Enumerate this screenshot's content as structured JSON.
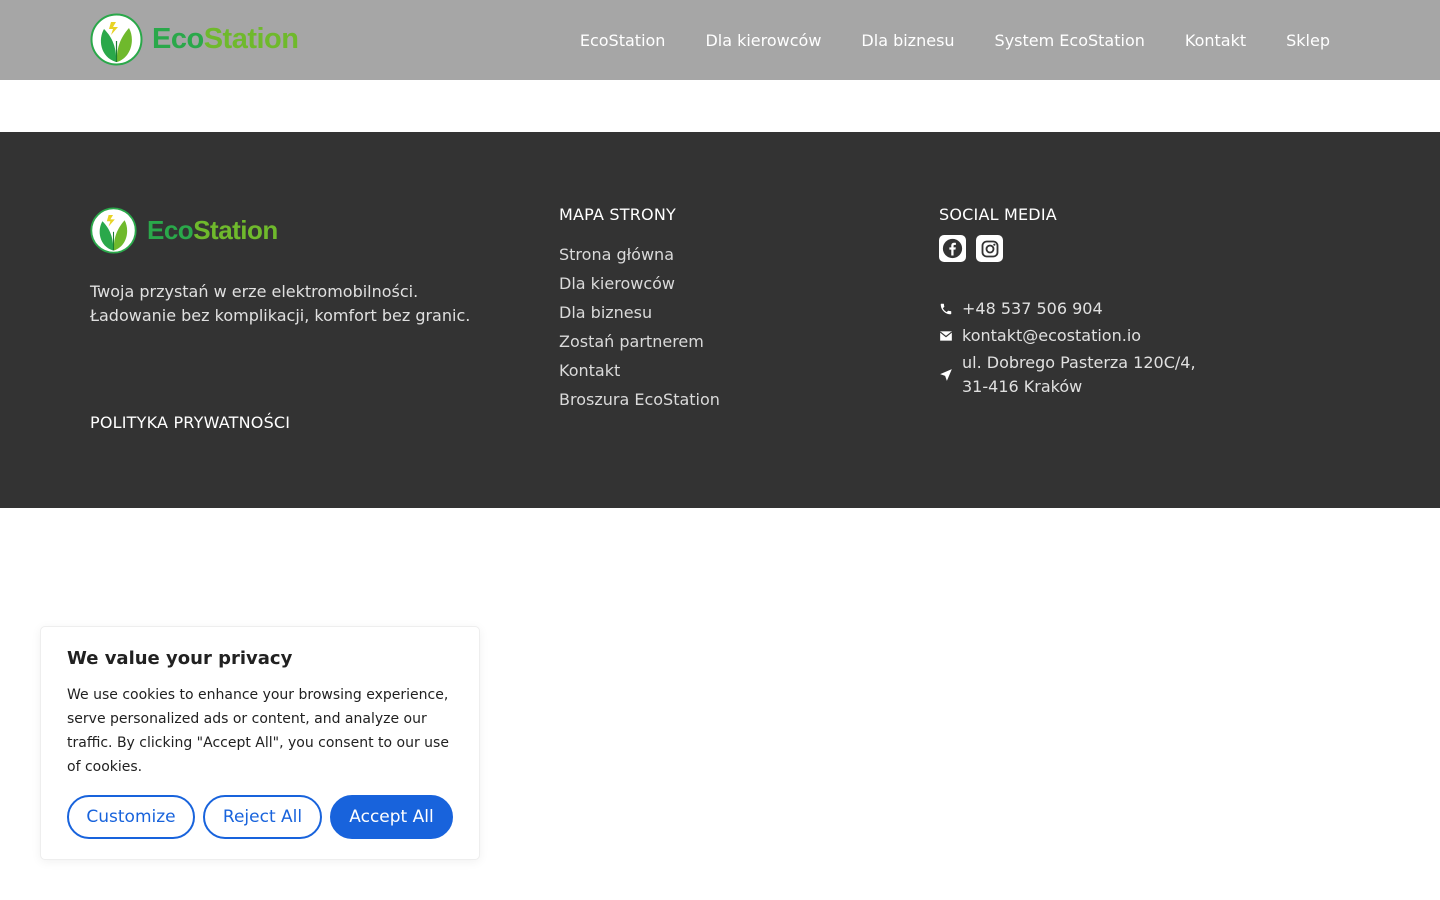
{
  "header": {
    "logo": {
      "part1": "Eco",
      "part2": "Station"
    },
    "nav": [
      {
        "label": "EcoStation"
      },
      {
        "label": "Dla kierowców"
      },
      {
        "label": "Dla biznesu"
      },
      {
        "label": "System EcoStation"
      },
      {
        "label": "Kontakt"
      },
      {
        "label": "Sklep"
      }
    ]
  },
  "footer": {
    "logo": {
      "part1": "Eco",
      "part2": "Station"
    },
    "tagline": {
      "line1": "Twoja przystań w erze elektromobilności.",
      "line2": "Ładowanie bez komplikacji, komfort bez granic."
    },
    "privacy_label": "POLITYKA PRYWATNOŚCI",
    "sitemap": {
      "title": "MAPA STRONY",
      "items": [
        "Strona główna",
        "Dla kierowców",
        "Dla biznesu",
        "Zostań partnerem",
        "Kontakt",
        "Broszura EcoStation"
      ]
    },
    "social": {
      "title": "SOCIAL MEDIA",
      "icons": [
        "facebook-icon",
        "instagram-icon"
      ]
    },
    "contact": {
      "phone": "+48 537 506 904",
      "email": "kontakt@ecostation.io",
      "address_line1": "ul. Dobrego Pasterza 120C/4,",
      "address_line2": "31-416 Kraków"
    }
  },
  "cookie_banner": {
    "title": "We value your privacy",
    "text": "We use cookies to enhance your browsing experience, serve personalized ads or content, and analyze our traffic. By clicking \"Accept All\", you consent to our use of cookies.",
    "customize_label": "Customize",
    "reject_label": "Reject All",
    "accept_label": "Accept All"
  },
  "colors": {
    "header_bg": "#a6a6a6",
    "footer_bg": "#333333",
    "brand_green": "#2aa84a",
    "brand_lime": "#6fb92c",
    "cookie_accent": "#1863dc"
  }
}
